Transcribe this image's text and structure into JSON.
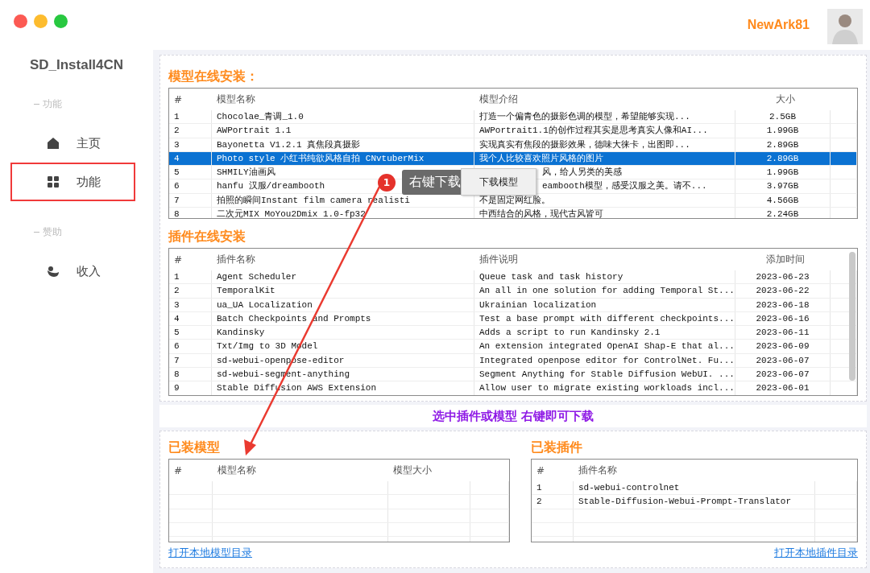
{
  "window": {
    "app_title": "SD_Install4CN"
  },
  "header": {
    "user_name": "NewArk81"
  },
  "sidebar": {
    "sections": [
      {
        "heading": "功能",
        "items": [
          {
            "label": "主页",
            "highlighted": false
          },
          {
            "label": "功能",
            "highlighted": true
          }
        ]
      },
      {
        "heading": "赞助",
        "items": [
          {
            "label": "收入",
            "highlighted": false
          }
        ]
      }
    ]
  },
  "model_section": {
    "title": "模型在线安装：",
    "columns": [
      "#",
      "模型名称",
      "模型介绍",
      "大小"
    ],
    "rows": [
      {
        "selected": false,
        "cells": [
          "1",
          "Chocolae_青调_1.0",
          "打造一个偏青色的摄影色调的模型，希望能够实现...",
          "2.5GB"
        ]
      },
      {
        "selected": false,
        "cells": [
          "2",
          "AWPortrait 1.1",
          "AWPortrait1.1的创作过程其实是思考真实人像和AI...",
          "1.99GB"
        ]
      },
      {
        "selected": false,
        "cells": [
          "3",
          "Bayonetta V1.2.1 真焦段真摄影",
          "实现真实有焦段的摄影效果，德味大徕卡，出图即...",
          "2.89GB"
        ]
      },
      {
        "selected": true,
        "cells": [
          "4",
          "Photo style 小红书纯欲风格自拍 CNvtuberMix",
          "我个人比较喜欢照片风格的图片",
          "2.89GB"
        ]
      },
      {
        "selected": false,
        "cells": [
          "5",
          "SHMILY油画风",
          {
            "text": "风，给人另类的美感",
            "cut_left": true
          },
          "1.99GB"
        ]
      },
      {
        "selected": false,
        "cells": [
          "6",
          "hanfu 汉服/dreambooth",
          {
            "text": "eambooth模型，感受汉服之美。请不...",
            "cut_left": true
          },
          "3.97GB"
        ]
      },
      {
        "selected": false,
        "cells": [
          "7",
          "拍照的瞬间Instant film camera realisti",
          "不是固定网红脸。",
          "4.56GB"
        ]
      },
      {
        "selected": false,
        "cells": [
          "8",
          "二次元MIX MoYou2Dmix 1.0-fp32",
          "中西结合的风格，现代古风皆可",
          "2.24GB"
        ]
      }
    ]
  },
  "plugin_section": {
    "title": "插件在线安装",
    "columns": [
      "#",
      "插件名称",
      "插件说明",
      "添加时间"
    ],
    "rows": [
      {
        "selected": false,
        "cells": [
          "1",
          "Agent Scheduler",
          "Queue task and task history",
          "2023-06-23"
        ]
      },
      {
        "selected": false,
        "cells": [
          "2",
          "TemporalKit",
          "An all in one solution for adding Temporal St...",
          "2023-06-22"
        ]
      },
      {
        "selected": false,
        "cells": [
          "3",
          "ua_UA Localization",
          "Ukrainian localization",
          "2023-06-18"
        ]
      },
      {
        "selected": false,
        "cells": [
          "4",
          "Batch Checkpoints and Prompts",
          "Test a base prompt with different checkpoints...",
          "2023-06-16"
        ]
      },
      {
        "selected": false,
        "cells": [
          "5",
          "Kandinsky",
          "Adds a script to run Kandinsky 2.1",
          "2023-06-11"
        ]
      },
      {
        "selected": false,
        "cells": [
          "6",
          "Txt/Img to 3D Model",
          "An extension integrated OpenAI Shap-E that al...",
          "2023-06-09"
        ]
      },
      {
        "selected": false,
        "cells": [
          "7",
          "sd-webui-openpose-editor",
          "Integrated openpose editor for ControlNet. Fu...",
          "2023-06-07"
        ]
      },
      {
        "selected": false,
        "cells": [
          "8",
          "sd-webui-segment-anything",
          "Segment Anything for Stable Diffusion WebUI. ...",
          "2023-06-07"
        ]
      },
      {
        "selected": false,
        "cells": [
          "9",
          "Stable Diffusion AWS Extension",
          "Allow user to migrate existing workloads incl...",
          "2023-06-01"
        ]
      }
    ]
  },
  "hint": "选中插件或模型 右键即可下载",
  "installed_models": {
    "title": "已装模型",
    "columns": [
      "#",
      "模型名称",
      "模型大小"
    ],
    "link": "打开本地模型目录"
  },
  "installed_plugins": {
    "title": "已装插件",
    "columns": [
      "#",
      "插件名称"
    ],
    "rows": [
      {
        "selected": false,
        "cells": [
          "1",
          "sd-webui-controlnet"
        ]
      },
      {
        "selected": false,
        "cells": [
          "2",
          "Stable-Diffusion-Webui-Prompt-Translator"
        ]
      }
    ],
    "link": "打开本地插件目录"
  },
  "annotation": {
    "step": "1",
    "tooltip": "右键下载"
  },
  "context_menu": {
    "items": [
      "下载模型"
    ]
  }
}
